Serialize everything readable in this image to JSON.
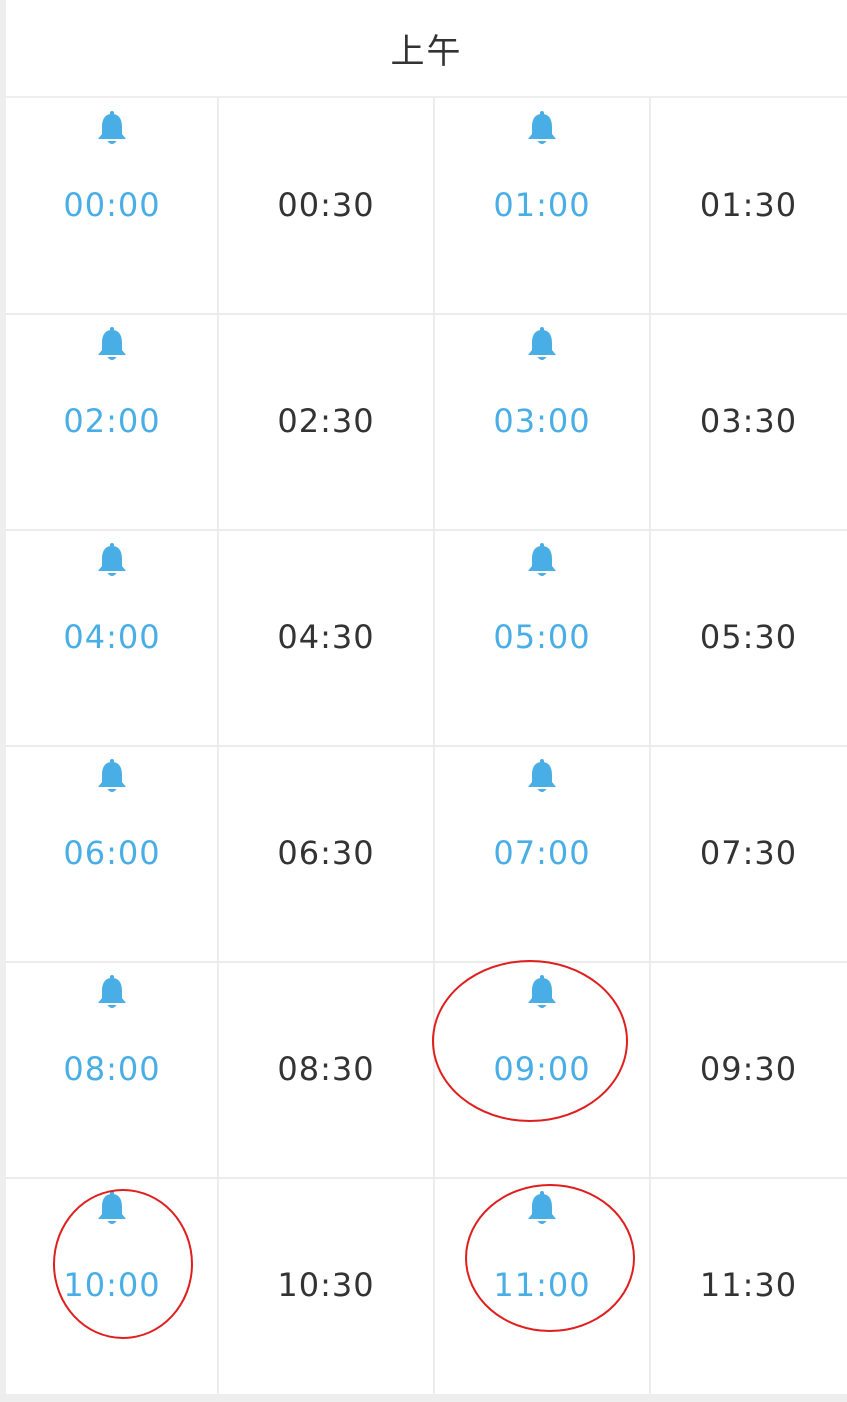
{
  "header": {
    "title": "上午"
  },
  "colors": {
    "accent": "#4aaee6",
    "text": "#333333",
    "annotation": "#e01e1e"
  },
  "slots": [
    {
      "time": "00:00",
      "alarm": true,
      "icon": "bell-icon"
    },
    {
      "time": "00:30",
      "alarm": false
    },
    {
      "time": "01:00",
      "alarm": true,
      "icon": "bell-icon"
    },
    {
      "time": "01:30",
      "alarm": false
    },
    {
      "time": "02:00",
      "alarm": true,
      "icon": "bell-icon"
    },
    {
      "time": "02:30",
      "alarm": false
    },
    {
      "time": "03:00",
      "alarm": true,
      "icon": "bell-icon"
    },
    {
      "time": "03:30",
      "alarm": false
    },
    {
      "time": "04:00",
      "alarm": true,
      "icon": "bell-icon"
    },
    {
      "time": "04:30",
      "alarm": false
    },
    {
      "time": "05:00",
      "alarm": true,
      "icon": "bell-icon"
    },
    {
      "time": "05:30",
      "alarm": false
    },
    {
      "time": "06:00",
      "alarm": true,
      "icon": "bell-icon"
    },
    {
      "time": "06:30",
      "alarm": false
    },
    {
      "time": "07:00",
      "alarm": true,
      "icon": "bell-icon"
    },
    {
      "time": "07:30",
      "alarm": false
    },
    {
      "time": "08:00",
      "alarm": true,
      "icon": "bell-icon"
    },
    {
      "time": "08:30",
      "alarm": false
    },
    {
      "time": "09:00",
      "alarm": true,
      "icon": "bell-icon",
      "highlighted": true
    },
    {
      "time": "09:30",
      "alarm": false
    },
    {
      "time": "10:00",
      "alarm": true,
      "icon": "bell-icon",
      "highlighted": true
    },
    {
      "time": "10:30",
      "alarm": false
    },
    {
      "time": "11:00",
      "alarm": true,
      "icon": "bell-icon",
      "highlighted": true
    },
    {
      "time": "11:30",
      "alarm": false
    }
  ]
}
